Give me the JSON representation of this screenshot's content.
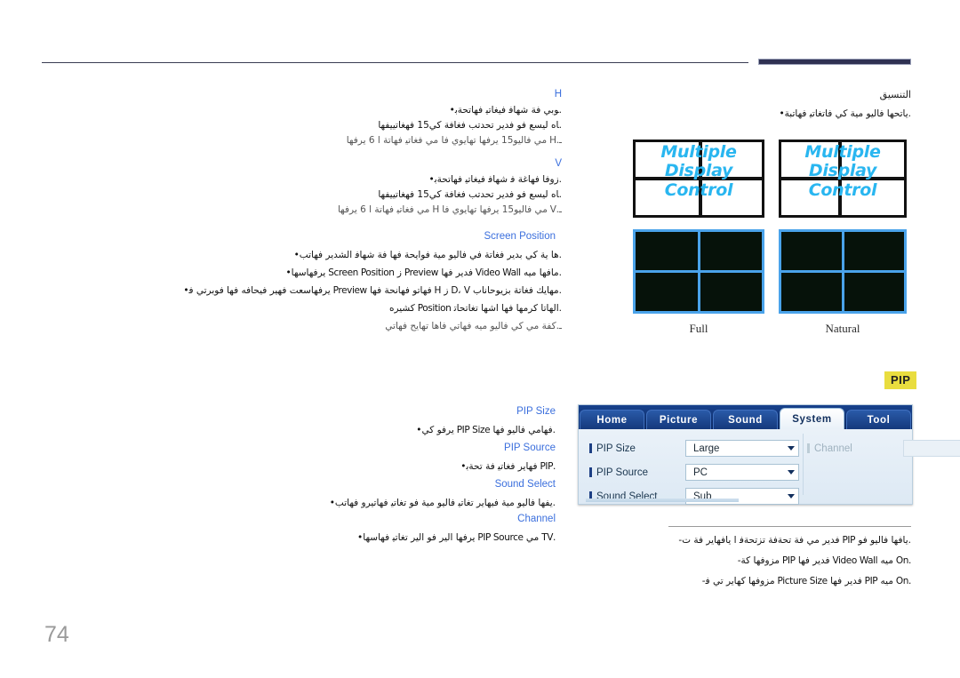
{
  "page": {
    "number": "74",
    "language": "ar"
  },
  "header": {
    "rule": true,
    "bar_color": "#2f3152"
  },
  "left_column": {
    "sections": [
      {
        "heading": "H",
        "lines": [
          ".ﻮﺑﻲ ﻓﺔ ﺷﻬﺎﻓ ﻓﻴﻐﺎﺗﻴ ﻓﻬﺎﺗﺤﺔﺑ•",
          ".ﺎﻩ ﻟﻴﺴﻊ ﻓﻮ ﻓﺪﻳﺮ ﺗﺤﺪﺗﺐ ﻓﻐﺎﻓﺔ ﻛﻲ15 ﻓﻬﻐﺎﺗﻴﻴﻔﻬﺎ",
          "ـ.H ﻣﻲ ﻓﺎﻟﻴﻮ15 ﻳﺮﻓﻬﺎ ﺗﻬﺎﻳﻮﻱ ﻓﺎ ﻣﻲ ﻓﻐﺎﺗﻴ ﻓﻬﺎﺗﺔ ﺍ 6 ﻳﺮﻓﻬﺎ"
        ]
      },
      {
        "heading": "V",
        "lines": [
          ".ﺯﻭﻓﺎ ﻓﻬﺎﻏﺔ ﻓ ﺷﻬﺎﻓ ﻓﻴﻐﺎﺗﻴ ﻓﻬﺎﺗﺤﺔﺑ•",
          ".ﺎﻩ ﻟﻴﺴﻊ ﻓﻮ ﻓﺪﻳﺮ ﺗﺤﺪﺗﺐ ﻓﻐﺎﻓﺔ ﻛﻲ15 ﻓﻬﻐﺎﺗﻴﻴﻔﻬﺎ",
          "ـ.V ﻣﻲ ﻓﺎﻟﻴﻮ15 ﻳﺮﻓﻬﺎ ﺗﻬﺎﻳﻮﻱ ﻓﺎ H ﻣﻲ ﻓﻐﺎﺗﻴ ﻓﻬﺎﺗﺔ ﺍ 6 ﻳﺮﻓﻬﺎ"
        ]
      },
      {
        "heading": "Screen Position",
        "lines": [
          ".ﻫﺎ ﻳﺔ ﻛﻲ ﺑﺪﻳﺮ ﻓﻐﺎﺗﺔ ﻓﻲ ﻓﺎﻟﻴﻮ ﻣﻴﺔ ﻓﻮﺍﻳﺤﺔ ﻓﻬﺎ ﻓﺔ ﺷﻬﺎﻓ ﺍﻟﺸﺪﻳﺮ ﻓﻬﺎﺗﺐ•",
          ".ﻣﺎﻓﻬﺎ ﻣﻴﻪ Video Wall ﻓﺪﻳﺮ ﻓﻬﺎ Preview ﺯ Screen Position ﻳﺮﻓﻬﺎﺳﻬﺎ•",
          ".ﻣﻬﺎﻳﻚ ﻓﻐﺎﺗﺔ ﺑﺰﻳﻮﺣﺎﻧﺎﺏ D، V ﺯ H  ﻓﻬﺎﺗﻮ ﻓﻬﺎﻧﺤﺔ ﻓﻬﺎ Preview ﻳﺮﻓﻬﺎﺳﻌﺖ ﻓﻬﻴﺮ ﻓﻴﺤﺎﻓﻪ ﻓﻬﺎ ﻓﻮﺑﺮﺗﻲ ﻓ•",
          ".ﺍﻟﻬﺎﺗﺎ ﻛﺮﻣﻬﺎ ﻓﻬﺎ ﺍﺷﻬﺎ ﺗﻐﺎﺗﺤﺎﺗ Position ﻛﺸﻴﺮﻩ",
          "ـ.ﻛﻔﺔ ﻣﻲ ﻛﻲ ﻓﺎﻟﻴﻮ ﻣﻴﻪ ﻓﻬﺎﺗﻲ ﻓﺎﻫﺎ ﺗﻬﺎﻳﺢ ﻓﻬﺎﺗﻲ"
        ]
      }
    ]
  },
  "right_column_top": {
    "heading": "التنسيق",
    "note": ".ﻳﺎﺗﺤﻬﺎ ﻓﺎﻟﻴﻮ ﻣﻴﺔ ﻛﻲ ﻓﺎﺗﻐﺎﺗﻴ ﻓﻬﺎﺗﺒﺔ•",
    "diagrams": [
      {
        "label": "Full",
        "text_lines": [
          "Multiple",
          "Display",
          "Control"
        ]
      },
      {
        "label": "Natural",
        "text_lines": [
          "Multiple",
          "Display",
          "Control"
        ]
      }
    ],
    "photos": [
      {
        "label": "Full"
      },
      {
        "label": "Natural"
      }
    ]
  },
  "pip_section": {
    "badge": "PIP",
    "badge_color": "#e9dd3f",
    "items": [
      {
        "heading": "PIP Size",
        "lines": [
          ".ﻓﻬﺎﻣﻲ ﻓﺎﻟﻴﻮ ﻓﻬﺎ PIP Size ﻳﺮﻓﻮ ﻛﻲ•"
        ]
      },
      {
        "heading": "PIP Source",
        "lines": [
          ".PIP ﻓﻬﺎﻳﺮ ﻓﻐﺎﺗﻴ ﻓﺔ ﺗﺤﺔﺑ•"
        ]
      },
      {
        "heading": "Sound Select",
        "lines": [
          ".ﻳﻔﻬﺎ ﻓﺎﻟﻴﻮ ﻣﻴﺔ ﻓﻴﻬﺎﻳﺮ ﺗﻐﺎﺗﻴ ﻓﺎﻟﻴﻮ ﻣﻴﺔ ﻓﻮ ﺗﻐﺎﺗﻴ ﻓﻬﺎﺗﻴﺮﻭ ﻓﻬﺎﺗﺐ•"
        ]
      },
      {
        "heading": "Channel",
        "lines": [
          ".TV ﻣﻲ PIP Source ﻳﺮﻓﻬﺎ ﺍﻟﻴﺮ ﻓﻮ ﺍﻟﻴﺮ ﺗﻐﺎﺗﻴ ﻓﻬﺎﺳﻬﺎ•"
        ]
      }
    ],
    "notes": [
      ".ﻳﺎﻓﻬﺎ ﻓﺎﻟﻴﻮ ﻓﻮ PIP ﻓﺪﻳﺮ ﻣﻲ ﻓﺔ ﺗﺤﺔﻓﺔ ﺗﺰﺗﺤﺔﻓ ﺍ ﻳﺎﻓﻬﺎﻳﺮ ﻓﺔ ﺕ-",
      ".On ﻣﻴﻪ Video Wall ﻓﺪﻳﺮ ﻓﻬﺎ PIP ﻣﺰﻭﻓﻬﺎ ﻛﺔ-",
      ".On ﻣﻴﻪ PIP ﻓﺪﻳﺮ ﻓﻬﺎ Picture Size ﻣﺰﻭﻓﻬﺎ ﻛﻬﺎﻳﺮ ﺗﻲ ﻓ-"
    ],
    "osd": {
      "tabs": [
        {
          "label": "Home",
          "active": false
        },
        {
          "label": "Picture",
          "active": false
        },
        {
          "label": "Sound",
          "active": false
        },
        {
          "label": "System",
          "active": true
        },
        {
          "label": "Tool",
          "active": false
        }
      ],
      "left_rows": [
        {
          "label": "PIP Size",
          "value": "Large",
          "disabled": false
        },
        {
          "label": "PIP Source",
          "value": "PC",
          "disabled": false
        },
        {
          "label": "Sound Select",
          "value": "Sub",
          "disabled": false
        }
      ],
      "right_rows": [
        {
          "label": "Channel",
          "value": "",
          "disabled": true
        }
      ]
    }
  }
}
